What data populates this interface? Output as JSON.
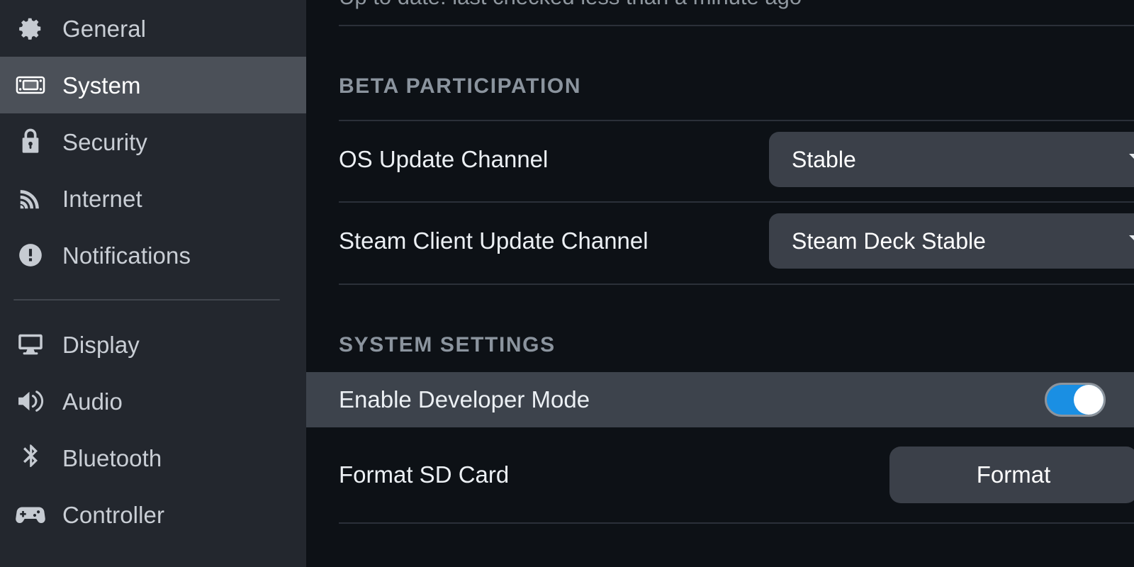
{
  "sidebar": {
    "items": [
      {
        "id": "general",
        "label": "General",
        "icon": "gear-icon",
        "selected": false
      },
      {
        "id": "system",
        "label": "System",
        "icon": "steam-deck-icon",
        "selected": true
      },
      {
        "id": "security",
        "label": "Security",
        "icon": "lock-icon",
        "selected": false
      },
      {
        "id": "internet",
        "label": "Internet",
        "icon": "wifi-icon",
        "selected": false
      },
      {
        "id": "notifications",
        "label": "Notifications",
        "icon": "alert-circle-icon",
        "selected": false
      }
    ],
    "items_lower": [
      {
        "id": "display",
        "label": "Display",
        "icon": "monitor-icon",
        "selected": false
      },
      {
        "id": "audio",
        "label": "Audio",
        "icon": "speaker-icon",
        "selected": false
      },
      {
        "id": "bluetooth",
        "label": "Bluetooth",
        "icon": "bluetooth-icon",
        "selected": false
      },
      {
        "id": "controller",
        "label": "Controller",
        "icon": "gamepad-icon",
        "selected": false
      }
    ]
  },
  "content": {
    "update_status": "Up to date: last checked less than a minute ago",
    "sections": [
      {
        "id": "beta-participation",
        "header": "BETA PARTICIPATION",
        "rows": [
          {
            "id": "os-update-channel",
            "label": "OS Update Channel",
            "control": "dropdown",
            "value": "Stable",
            "caret": "chevron-down-icon"
          },
          {
            "id": "steam-client-update-channel",
            "label": "Steam Client Update Channel",
            "control": "dropdown",
            "value": "Steam Deck Stable",
            "caret": "chevron-down-icon"
          }
        ]
      },
      {
        "id": "system-settings",
        "header": "SYSTEM SETTINGS",
        "rows": [
          {
            "id": "enable-developer-mode",
            "label": "Enable Developer Mode",
            "control": "toggle",
            "value": "on",
            "highlighted": true
          },
          {
            "id": "format-sd-card",
            "label": "Format SD Card",
            "control": "button",
            "value": "Format"
          }
        ]
      }
    ]
  },
  "colors": {
    "sidebar_bg": "#23272e",
    "sidebar_selected": "#4b5058",
    "content_bg": "#0d1116",
    "row_highlight": "#3d434c",
    "control_bg": "#3b4049",
    "toggle_on": "#1a8fe3",
    "toggle_knob": "#ffffff",
    "header_text": "#8b949e",
    "primary_text": "#ecf0f4",
    "divider": "#2b3039"
  }
}
